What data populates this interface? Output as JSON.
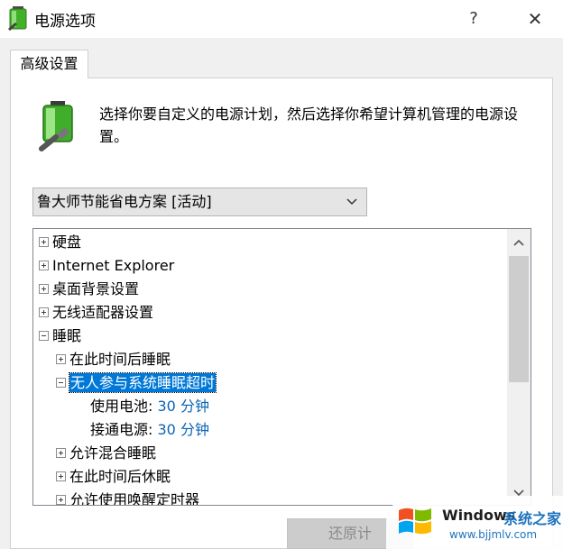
{
  "window": {
    "title": "电源选项",
    "help_glyph": "?",
    "close_glyph": "✕"
  },
  "tab": {
    "label": "高级设置"
  },
  "description": "选择你要自定义的电源计划，然后选择你希望计算机管理的电源设置。",
  "plan_select": {
    "value": "鲁大师节能省电方案 [活动]"
  },
  "tree": {
    "items": [
      {
        "label": "硬盘",
        "expander": "plus"
      },
      {
        "label": "Internet Explorer",
        "expander": "plus"
      },
      {
        "label": "桌面背景设置",
        "expander": "plus"
      },
      {
        "label": "无线适配器设置",
        "expander": "plus"
      },
      {
        "label": "睡眠",
        "expander": "minus"
      },
      {
        "label": "在此时间后睡眠",
        "expander": "plus"
      },
      {
        "label": "无人参与系统睡眠超时",
        "expander": "minus",
        "selected": true
      },
      {
        "label": "使用电池:",
        "value": "30 分钟"
      },
      {
        "label": "接通电源:",
        "value": "30 分钟"
      },
      {
        "label": "允许混合睡眠",
        "expander": "plus"
      },
      {
        "label": "在此时间后休眠",
        "expander": "plus"
      },
      {
        "label": "允许使用唤醒定时器",
        "expander": "plus"
      }
    ]
  },
  "buttons": {
    "restore_label": "还原计"
  },
  "watermark": {
    "brand": "Windows",
    "site": "系统之家",
    "url": "www.bjjmlv.com"
  },
  "colors": {
    "accent": "#0078d7",
    "link": "#0a64b4",
    "dialog_bg": "#f0f0f0"
  }
}
